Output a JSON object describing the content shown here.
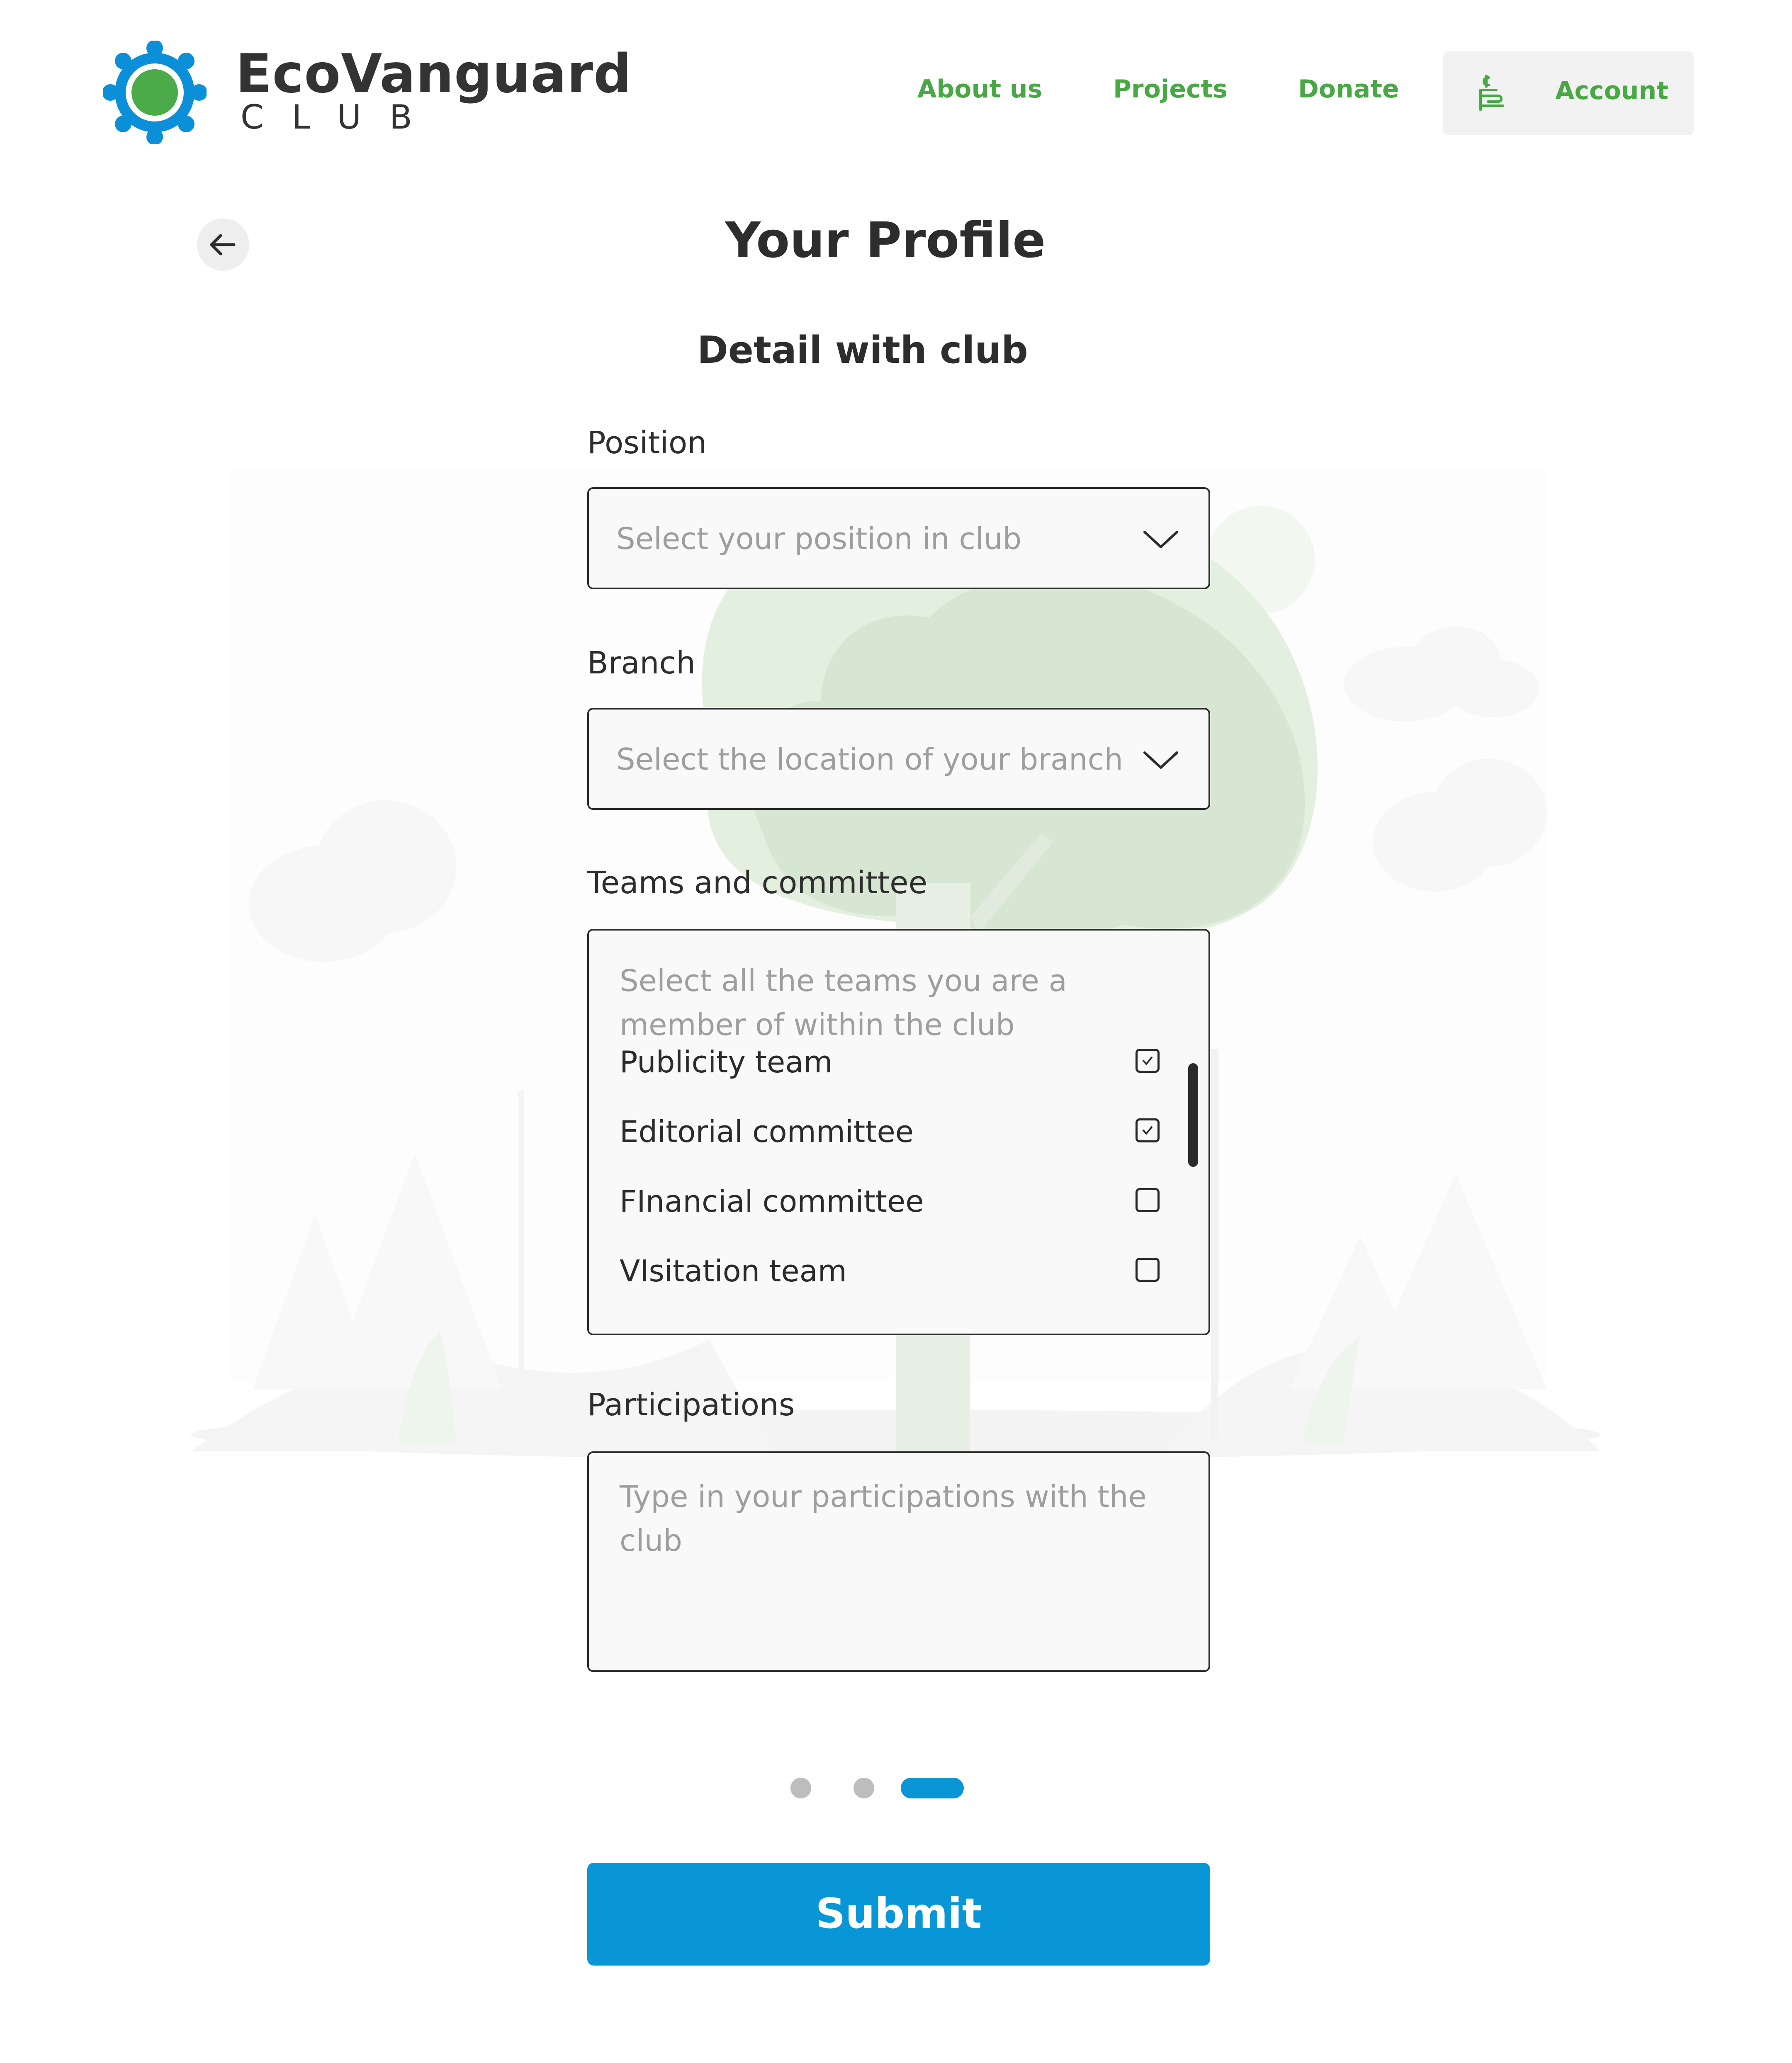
{
  "brand": {
    "name": "EcoVanguard",
    "subtitle": "CLUB",
    "ring_color": "#0b8fd8",
    "center_color": "#4cab49"
  },
  "nav": {
    "links": [
      "About us",
      "Projects",
      "Donate"
    ],
    "account_label": "Account",
    "account_icon": "hand-coin-icon",
    "link_color": "#48a844"
  },
  "header": {
    "back_icon": "arrow-left-icon",
    "page_title": "Your Profile",
    "section_title": "Detail with club"
  },
  "form": {
    "position": {
      "label": "Position",
      "placeholder": "Select your position in club"
    },
    "branch": {
      "label": "Branch",
      "placeholder": "Select the location of your branch"
    },
    "teams": {
      "label": "Teams and committee",
      "placeholder": "Select all the teams you are a member of within the club",
      "items": [
        {
          "label": "Publicity team",
          "checked": true
        },
        {
          "label": "Editorial committee",
          "checked": true
        },
        {
          "label": "FInancial committee",
          "checked": false
        },
        {
          "label": "VIsitation team",
          "checked": false
        }
      ]
    },
    "participations": {
      "label": "Participations",
      "placeholder": "Type in your participations with the club"
    }
  },
  "pager": {
    "total_steps": 3,
    "current_step": 3,
    "active_color": "#0a96d6"
  },
  "submit": {
    "label": "Submit",
    "color": "#0896d7"
  }
}
